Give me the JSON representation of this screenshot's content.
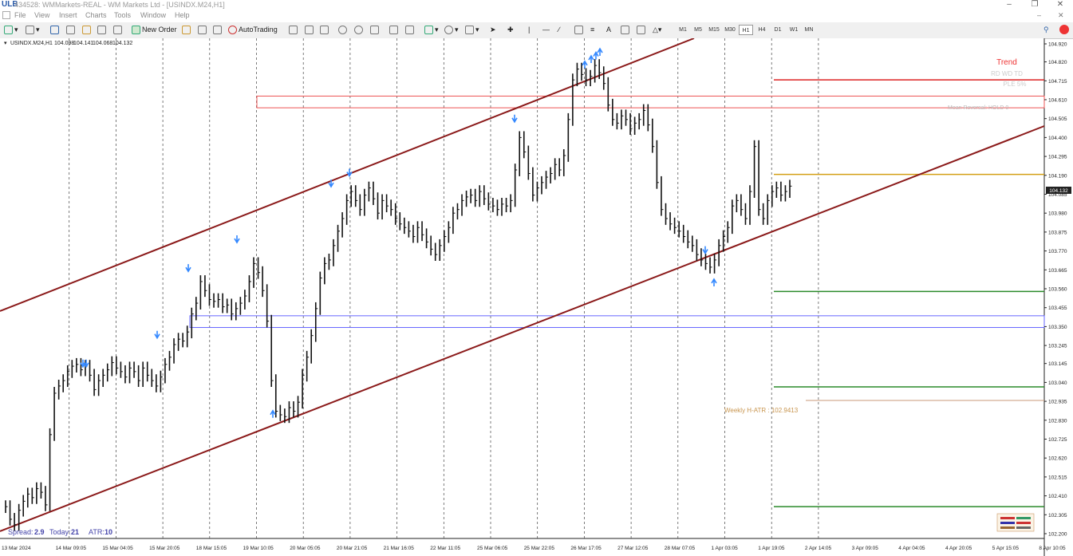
{
  "window": {
    "logo": "ULB",
    "title": "434528: WMMarkets-REAL - WM Markets Ltd - [USINDX.M24,H1]"
  },
  "menu": [
    "File",
    "View",
    "Insert",
    "Charts",
    "Tools",
    "Window",
    "Help"
  ],
  "toolbar": {
    "new_order": "New Order",
    "autotrading": "AutoTrading",
    "timeframes": [
      "M1",
      "M5",
      "M15",
      "M30",
      "H1",
      "H4",
      "D1",
      "W1",
      "MN"
    ],
    "active_tf": "H1"
  },
  "chart_info": {
    "symbol": "USINDX.M24,H1",
    "ohlc": [
      "104.098",
      "104.141",
      "104.068",
      "104.132"
    ],
    "current_price": "104.132"
  },
  "indicator": {
    "trend_title": "Trend",
    "trend_cols": "RD  WD  TD",
    "trend_row2": "PLE  5%",
    "mean_rev": "Mean Reversal:  HOLD    0",
    "atr_label": "Weekly H-ATR : 102.9413"
  },
  "bottom_info": {
    "spread_label": "Spread:",
    "spread": "2.9",
    "today_label": "Today:",
    "today": "21",
    "atr_label": "ATR:",
    "atr": "10"
  },
  "colors": {
    "channel": "#8b1a1a",
    "supply": "#e55",
    "demand": "#66f",
    "red_level": "#dd2222",
    "gold_level": "#d4a017",
    "green_level": "#2a8a2a",
    "atr_level": "#c89a7a",
    "arrow": "#3388ff"
  },
  "chart_data": {
    "type": "line",
    "symbol": "USINDX.M24,H1",
    "price_axis": [
      "104.920",
      "104.820",
      "104.715",
      "104.610",
      "104.505",
      "104.400",
      "104.295",
      "104.190",
      "104.085",
      "103.980",
      "103.875",
      "103.770",
      "103.665",
      "103.560",
      "103.455",
      "103.350",
      "103.245",
      "103.145",
      "103.040",
      "102.935",
      "102.830",
      "102.725",
      "102.620",
      "102.515",
      "102.410",
      "102.305",
      "102.200"
    ],
    "time_axis": [
      "13 Mar 2024",
      "14 Mar 09:05",
      "15 Mar 04:05",
      "15 Mar 20:05",
      "18 Mar 15:05",
      "19 Mar 10:05",
      "20 Mar 05:05",
      "20 Mar 21:05",
      "21 Mar 16:05",
      "22 Mar 11:05",
      "25 Mar 06:05",
      "25 Mar 22:05",
      "26 Mar 17:05",
      "27 Mar 12:05",
      "28 Mar 07:05",
      "1 Apr 03:05",
      "1 Apr 19:05",
      "2 Apr 14:05",
      "3 Apr 09:05",
      "4 Apr 04:05",
      "4 Apr 20:05",
      "5 Apr 15:05",
      "8 Apr 10:05"
    ],
    "ylim": [
      102.2,
      104.96
    ],
    "series": [
      {
        "values": [
          102.35,
          102.28,
          102.25,
          102.33,
          102.38,
          102.42,
          102.4,
          102.45,
          102.43,
          102.36,
          102.75,
          102.98,
          103.02,
          103.05,
          103.1,
          103.13,
          103.14,
          103.11,
          103.13,
          103.08,
          103.0,
          103.05,
          103.08,
          103.11,
          103.15,
          103.12,
          103.1,
          103.07,
          103.12,
          103.1,
          103.05,
          103.12,
          103.08,
          103.05,
          103.02,
          103.07,
          103.14,
          103.18,
          103.25,
          103.28,
          103.27,
          103.32,
          103.42,
          103.48,
          103.6,
          103.55,
          103.5,
          103.49,
          103.5,
          103.46,
          103.47,
          103.42,
          103.45,
          103.48,
          103.52,
          103.6,
          103.7,
          103.65,
          103.55,
          103.38,
          103.05,
          102.88,
          102.86,
          102.85,
          102.9,
          102.88,
          102.93,
          103.08,
          103.18,
          103.3,
          103.45,
          103.62,
          103.7,
          103.72,
          103.8,
          103.88,
          103.95,
          104.05,
          104.1,
          104.05,
          104.0,
          104.08,
          104.12,
          104.06,
          103.98,
          104.05,
          104.02,
          104.0,
          103.95,
          103.92,
          103.9,
          103.88,
          103.85,
          103.9,
          103.86,
          103.82,
          103.78,
          103.75,
          103.8,
          103.85,
          103.9,
          103.98,
          104.0,
          104.05,
          104.07,
          104.08,
          104.05,
          104.1,
          104.06,
          104.03,
          104.02,
          104.0,
          104.03,
          104.02,
          104.05,
          104.22,
          104.4,
          104.32,
          104.2,
          104.08,
          104.12,
          104.15,
          104.18,
          104.2,
          104.25,
          104.22,
          104.3,
          104.5,
          104.72,
          104.78,
          104.75,
          104.72,
          104.74,
          104.8,
          104.76,
          104.7,
          104.58,
          104.5,
          104.48,
          104.52,
          104.5,
          104.45,
          104.48,
          104.5,
          104.55,
          104.47,
          104.35,
          104.15,
          104.0,
          103.95,
          103.92,
          103.9,
          103.88,
          103.85,
          103.82,
          103.8,
          103.75,
          103.72,
          103.7,
          103.68,
          103.72,
          103.8,
          103.85,
          103.9,
          104.02,
          104.05,
          104.0,
          103.95,
          104.1,
          104.35,
          104.0,
          103.95,
          104.05,
          104.1,
          104.12,
          104.08,
          104.1,
          104.13
        ]
      }
    ]
  }
}
